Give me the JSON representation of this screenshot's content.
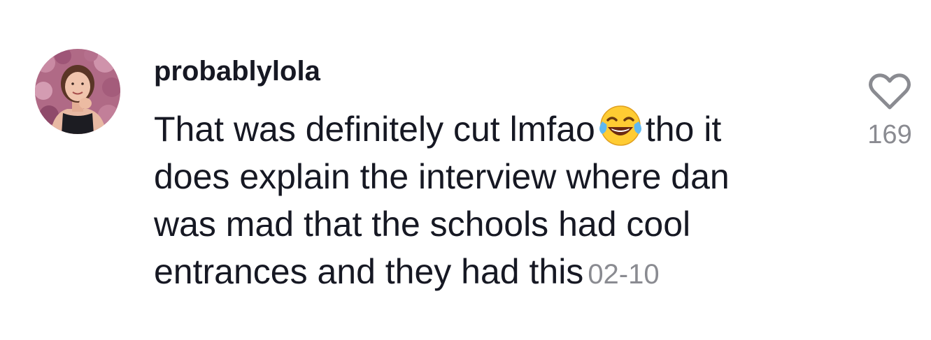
{
  "comment": {
    "username": "probablylola",
    "text_lines": [
      "That was definitely cut lmfao",
      "tho it",
      "does explain the interview where dan",
      "was mad that the schools had cool",
      "entrances and they had this"
    ],
    "emoji": "face-with-tears-of-joy-icon",
    "date": "02-10",
    "like_count": "169",
    "like_icon": "heart-outline-icon",
    "colors": {
      "text": "#161823",
      "secondary": "#8a8b91"
    }
  }
}
